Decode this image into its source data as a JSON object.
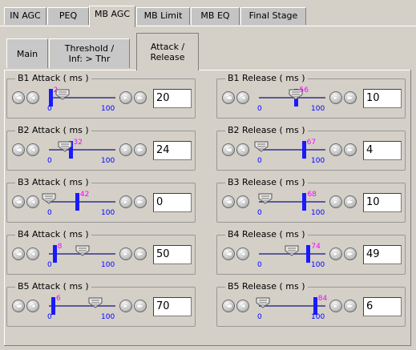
{
  "tabs": [
    "IN AGC",
    "PEQ",
    "MB AGC",
    "MB Limit",
    "MB EQ",
    "Final Stage"
  ],
  "active_tab": "MB AGC",
  "subtabs": [
    {
      "l1": "Main",
      "l2": ""
    },
    {
      "l1": "Threshold /",
      "l2": "Inf: > Thr"
    },
    {
      "l1": "Attack /",
      "l2": "Release"
    }
  ],
  "slider_min": "0",
  "slider_max": "100",
  "groups": [
    {
      "title": "B1 Attack ( ms )",
      "value": "20",
      "indicator": "2",
      "level": 20
    },
    {
      "title": "B1 Release ( ms )",
      "value": "10",
      "indicator": "56",
      "level": 56
    },
    {
      "title": "B2 Attack ( ms )",
      "value": "24",
      "indicator": "32",
      "level": 24
    },
    {
      "title": "B2 Release ( ms )",
      "value": "4",
      "indicator": "67",
      "level": 4
    },
    {
      "title": "B3 Attack ( ms )",
      "value": "0",
      "indicator": "42",
      "level": 0
    },
    {
      "title": "B3 Release ( ms )",
      "value": "10",
      "indicator": "68",
      "level": 10
    },
    {
      "title": "B4 Attack ( ms )",
      "value": "50",
      "indicator": "8",
      "level": 50
    },
    {
      "title": "B4 Release ( ms )",
      "value": "49",
      "indicator": "74",
      "level": 49
    },
    {
      "title": "B5 Attack ( ms )",
      "value": "70",
      "indicator": "6",
      "level": 70
    },
    {
      "title": "B5 Release ( ms )",
      "value": "6",
      "indicator": "84",
      "level": 6
    }
  ],
  "colors": {
    "indicator_label": "#ff00ff",
    "indicator_bar": "#1a1aff",
    "scale_label": "#0000ff"
  }
}
